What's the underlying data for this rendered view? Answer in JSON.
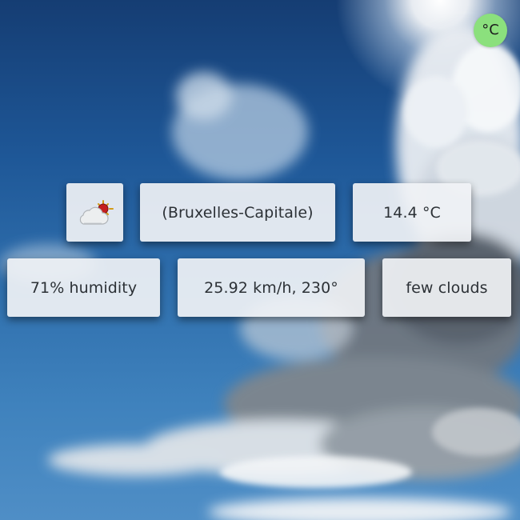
{
  "unit_toggle": {
    "label": "°C"
  },
  "weather": {
    "icon": "few-clouds-day-icon",
    "location": "(Bruxelles-Capitale)",
    "temperature": "14.4 °C",
    "humidity": "71% humidity",
    "wind": "25.92 km/h, 230°",
    "description": "few clouds"
  },
  "colors": {
    "toggle_bg": "#8be07d",
    "card_bg": "#f0f2f5",
    "sky_top": "#153d73",
    "sky_bottom": "#4f8ec6"
  }
}
